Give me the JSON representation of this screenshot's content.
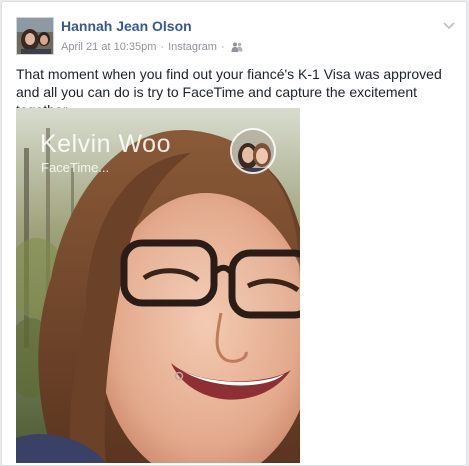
{
  "post": {
    "author": "Hannah Jean Olson",
    "timestamp": "April 21 at 10:35pm",
    "source": "Instagram",
    "separator": "·",
    "audience_icon": "friends-icon",
    "menu_icon": "chevron-down-icon",
    "text": "That moment when you find out your fiancé's K-1 Visa was approved and all you can do is try to FaceTime and capture the excitement together."
  },
  "photo": {
    "caller_name": "Kelvin Woo",
    "caller_status": "FaceTime..."
  },
  "colors": {
    "author_link": "#365899",
    "meta_text": "#90949c",
    "body_text": "#1d2129",
    "card_border": "#dddfe2",
    "page_background": "#e9ebee"
  }
}
